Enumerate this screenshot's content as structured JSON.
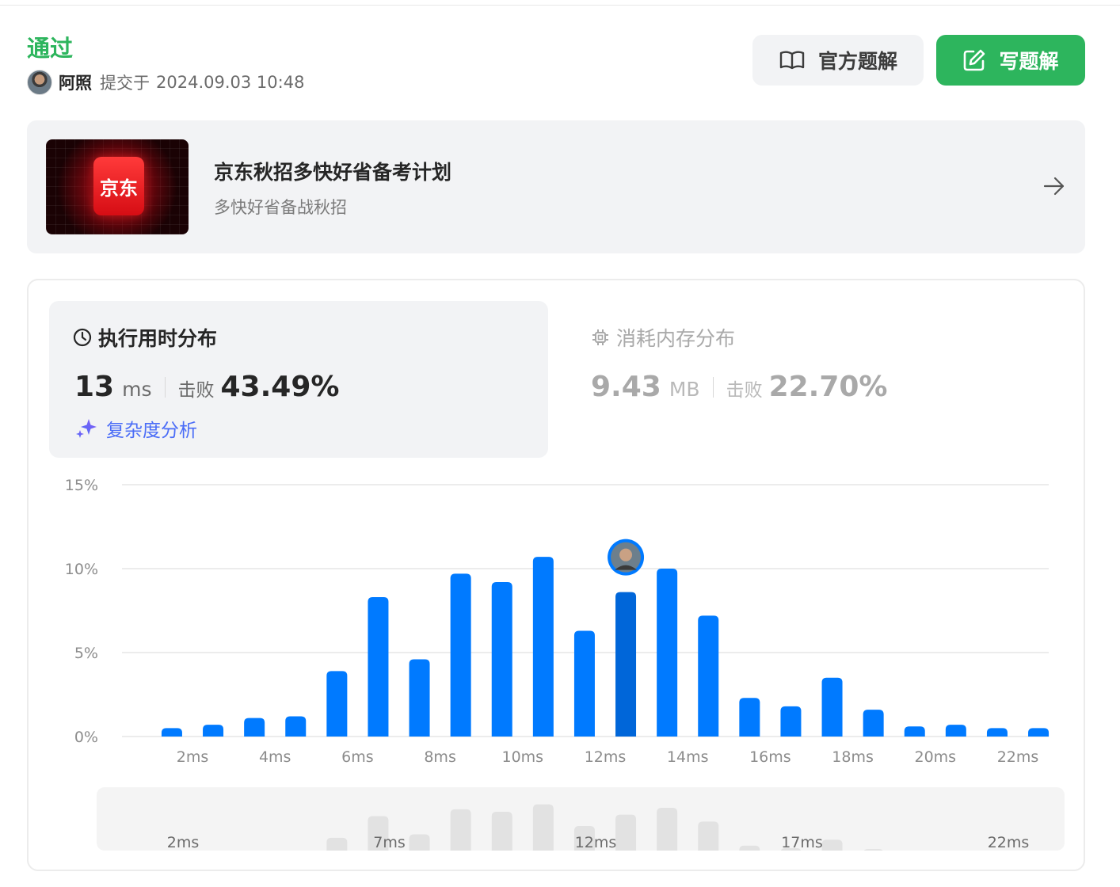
{
  "header": {
    "status": "通过",
    "user": "阿照",
    "submit_prefix": "提交于",
    "submit_time": "2024.09.03 10:48"
  },
  "actions": {
    "official_solution": "官方题解",
    "write_solution": "写题解"
  },
  "promo": {
    "logo_text": "京东",
    "title": "京东秋招多快好省备考计划",
    "subtitle": "多快好省备战秋招"
  },
  "runtime": {
    "title": "执行用时分布",
    "value": "13",
    "unit": "ms",
    "beat_label": "击败",
    "beat_pct": "43.49%",
    "analysis_label": "复杂度分析"
  },
  "memory": {
    "title": "消耗内存分布",
    "value": "9.43",
    "unit": "MB",
    "beat_label": "击败",
    "beat_pct": "22.70%"
  },
  "colors": {
    "accepted": "#2db55d",
    "bar": "#007aff",
    "bar_selected": "#0066d9",
    "mini_bar": "#e2e2e2",
    "analysis_text": "#4a6cf7"
  },
  "chart_data": {
    "type": "bar",
    "ylim": [
      0,
      15
    ],
    "yticks": [
      "0%",
      "5%",
      "10%",
      "15%"
    ],
    "x": [
      1,
      2,
      3,
      4,
      5,
      6,
      7,
      8,
      9,
      10,
      11,
      12,
      13,
      14,
      15,
      16,
      17,
      18,
      19,
      20,
      21,
      22,
      23
    ],
    "x_tick_labels": [
      "2ms",
      "4ms",
      "6ms",
      "8ms",
      "10ms",
      "12ms",
      "14ms",
      "16ms",
      "18ms",
      "20ms",
      "22ms"
    ],
    "x_tick_values": [
      2,
      4,
      6,
      8,
      10,
      12,
      14,
      16,
      18,
      20,
      22
    ],
    "values": [
      0.5,
      0.7,
      1.1,
      1.2,
      3.9,
      8.3,
      4.6,
      9.7,
      9.2,
      10.7,
      6.3,
      8.6,
      10.0,
      7.2,
      2.3,
      1.8,
      3.5,
      1.6,
      0.6,
      0.7,
      0.5,
      0.5
    ],
    "bar_x": [
      1.5,
      2.5,
      3.5,
      4.5,
      5.5,
      6.5,
      7.5,
      8.5,
      9.5,
      10.5,
      11.5,
      12.5,
      13.5,
      14.5,
      15.5,
      16.5,
      17.5,
      18.5,
      19.5,
      20.5,
      21.5,
      22.5
    ],
    "selected_x": 12.5,
    "grid": true,
    "navigator": {
      "x_tick_labels": [
        "2ms",
        "7ms",
        "12ms",
        "17ms",
        "22ms"
      ],
      "x_tick_values": [
        2,
        7,
        12,
        17,
        22
      ]
    }
  }
}
